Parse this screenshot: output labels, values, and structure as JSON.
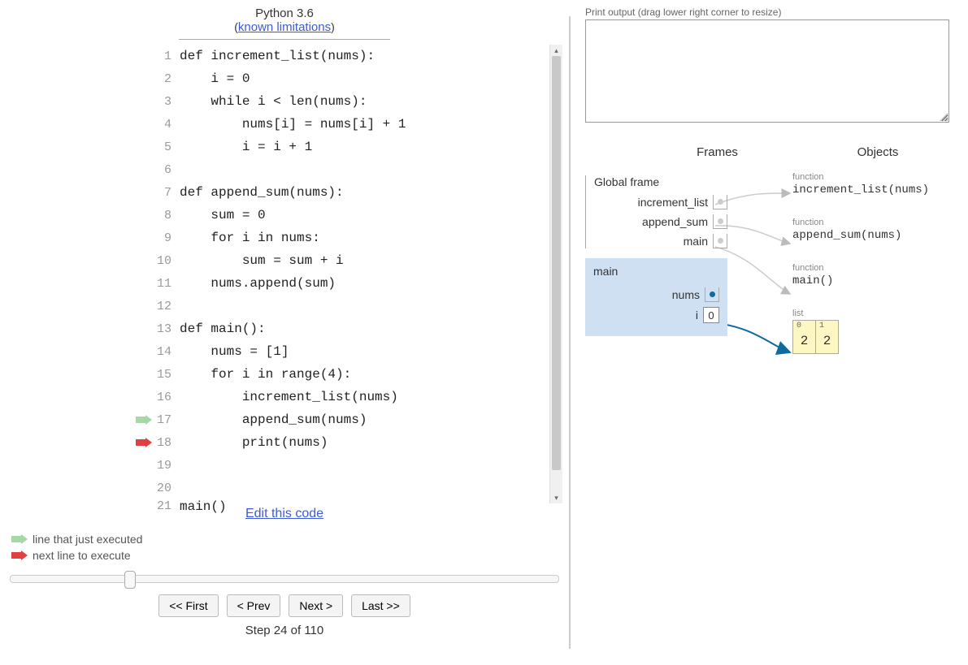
{
  "header": {
    "title": "Python 3.6",
    "link_prefix": "(",
    "link_text": "known limitations",
    "link_suffix": ")"
  },
  "code": {
    "lines": [
      {
        "n": 1,
        "text": "def increment_list(nums):"
      },
      {
        "n": 2,
        "text": "    i = 0"
      },
      {
        "n": 3,
        "text": "    while i < len(nums):"
      },
      {
        "n": 4,
        "text": "        nums[i] = nums[i] + 1"
      },
      {
        "n": 5,
        "text": "        i = i + 1"
      },
      {
        "n": 6,
        "text": ""
      },
      {
        "n": 7,
        "text": "def append_sum(nums):"
      },
      {
        "n": 8,
        "text": "    sum = 0"
      },
      {
        "n": 9,
        "text": "    for i in nums:"
      },
      {
        "n": 10,
        "text": "        sum = sum + i"
      },
      {
        "n": 11,
        "text": "    nums.append(sum)"
      },
      {
        "n": 12,
        "text": ""
      },
      {
        "n": 13,
        "text": "def main():"
      },
      {
        "n": 14,
        "text": "    nums = [1]"
      },
      {
        "n": 15,
        "text": "    for i in range(4):"
      },
      {
        "n": 16,
        "text": "        increment_list(nums)"
      },
      {
        "n": 17,
        "text": "        append_sum(nums)"
      },
      {
        "n": 18,
        "text": "        print(nums)"
      },
      {
        "n": 19,
        "text": ""
      },
      {
        "n": 20,
        "text": ""
      },
      {
        "n": 21,
        "text": "main()"
      }
    ],
    "prev_executed_line": 17,
    "next_line": 18
  },
  "edit_link": "Edit this code",
  "legend": {
    "prev": "line that just executed",
    "next": "next line to execute"
  },
  "slider": {
    "current": 24,
    "total": 110
  },
  "controls": {
    "first": "<< First",
    "prev": "< Prev",
    "next": "Next >",
    "last": "Last >>"
  },
  "step_label": "Step 24 of 110",
  "output": {
    "label": "Print output (drag lower right corner to resize)",
    "value": ""
  },
  "viz_headers": {
    "frames": "Frames",
    "objects": "Objects"
  },
  "frames": {
    "global": {
      "title": "Global frame",
      "vars": [
        {
          "name": "increment_list"
        },
        {
          "name": "append_sum"
        },
        {
          "name": "main"
        }
      ]
    },
    "main": {
      "title": "main",
      "vars": [
        {
          "name": "nums",
          "pointer": true
        },
        {
          "name": "i",
          "value": "0"
        }
      ]
    }
  },
  "objects": [
    {
      "type": "function",
      "label": "increment_list(nums)"
    },
    {
      "type": "function",
      "label": "append_sum(nums)"
    },
    {
      "type": "function",
      "label": "main()"
    },
    {
      "type": "list",
      "indices": [
        "0",
        "1"
      ],
      "values": [
        "2",
        "2"
      ]
    }
  ]
}
